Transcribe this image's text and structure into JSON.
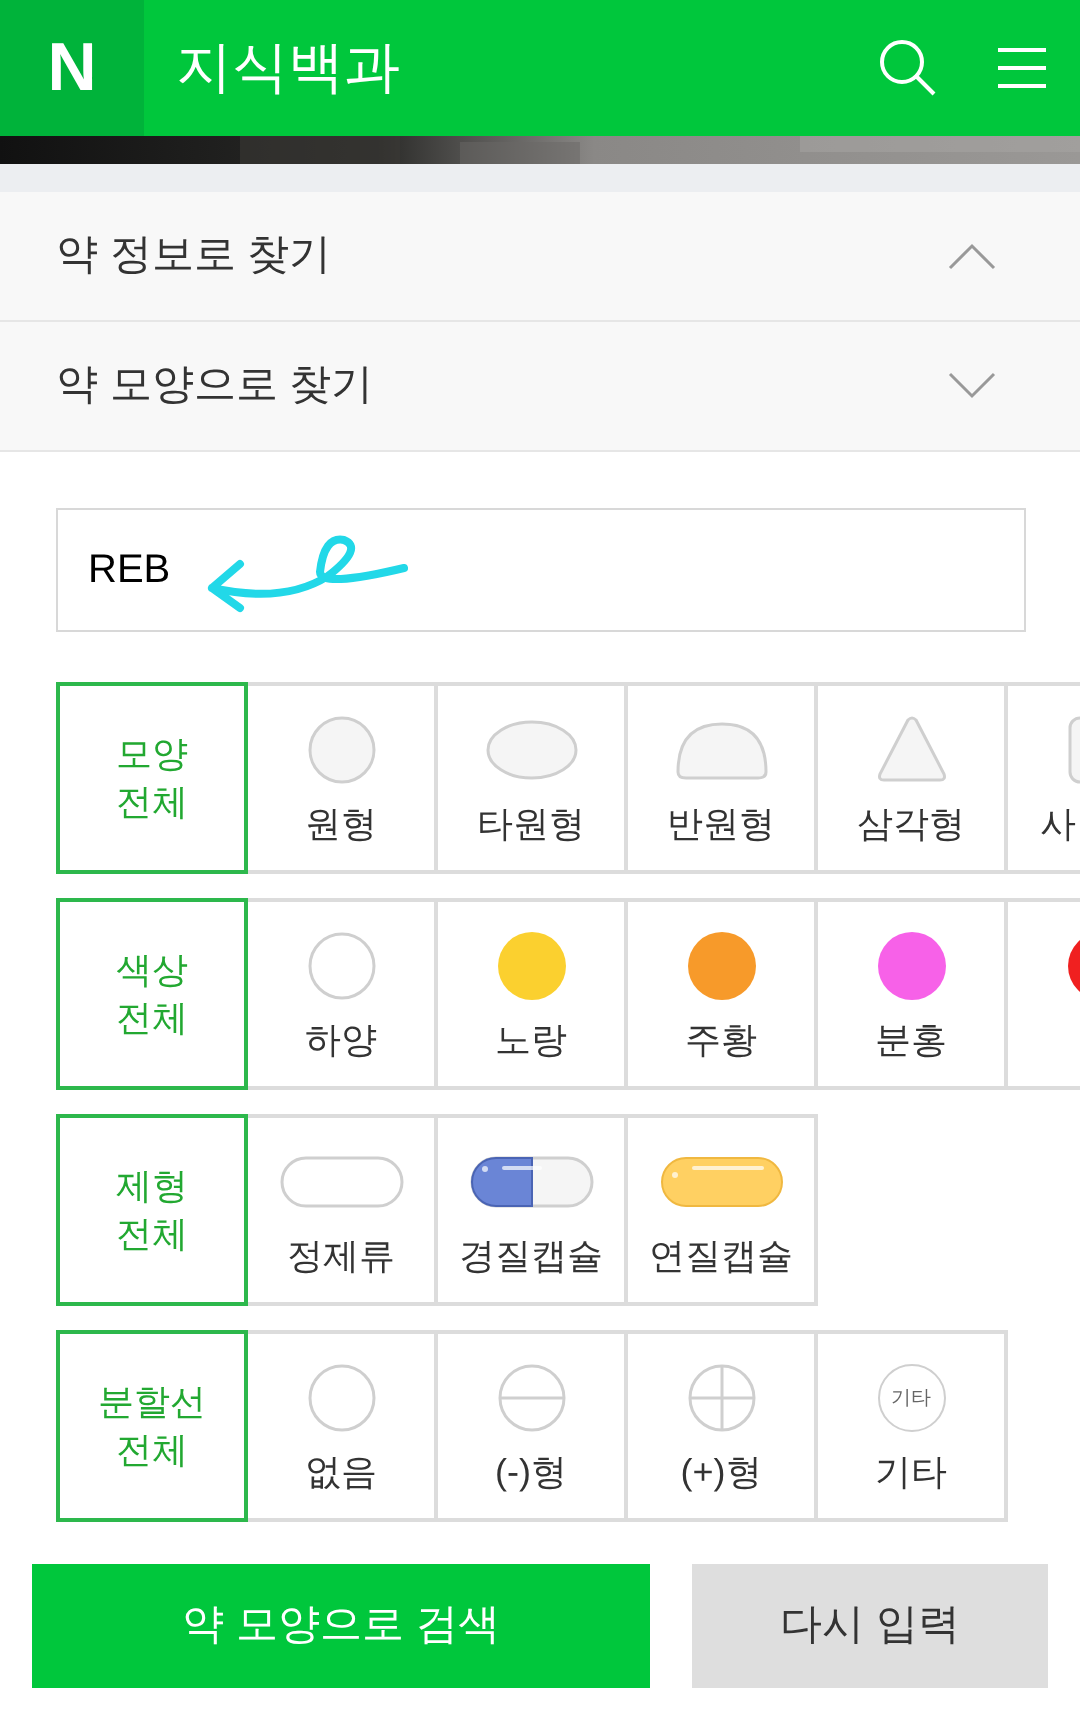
{
  "header": {
    "logo": "N",
    "title": "지식백과"
  },
  "accordion": [
    {
      "label": "약 정보로 찾기",
      "expanded": true
    },
    {
      "label": "약 모양으로 찾기",
      "expanded": false
    }
  ],
  "search": {
    "value": "REB"
  },
  "filters": [
    {
      "label": "모양 전체",
      "selected": true,
      "items": [
        {
          "kind": "circle",
          "label": "원형",
          "selected": false
        },
        {
          "kind": "oval",
          "label": "타원형",
          "selected": false
        },
        {
          "kind": "semicircle",
          "label": "반원형",
          "selected": false
        },
        {
          "kind": "triangle",
          "label": "삼각형",
          "selected": false
        },
        {
          "kind": "square",
          "label": "사",
          "selected": false
        }
      ]
    },
    {
      "label": "색상 전체",
      "selected": true,
      "items": [
        {
          "kind": "color",
          "color": "#ffffff",
          "label": "하양",
          "selected": false
        },
        {
          "kind": "color",
          "color": "#fbd02f",
          "label": "노랑",
          "selected": false
        },
        {
          "kind": "color",
          "color": "#f79a2a",
          "label": "주황",
          "selected": false
        },
        {
          "kind": "color",
          "color": "#f761e8",
          "label": "분홍",
          "selected": false
        },
        {
          "kind": "color",
          "color": "#f02020",
          "selected": false
        }
      ]
    },
    {
      "label": "제형 전체",
      "selected": true,
      "items": [
        {
          "kind": "tablet",
          "label": "정제류",
          "selected": false
        },
        {
          "kind": "hard_capsule",
          "label": "경질캡슐",
          "selected": false
        },
        {
          "kind": "soft_capsule",
          "label": "연질캡슐",
          "selected": false
        }
      ]
    },
    {
      "label": "분할선 전체",
      "selected": true,
      "items": [
        {
          "kind": "none",
          "label": "없음",
          "selected": false
        },
        {
          "kind": "minus",
          "label": "(-)형",
          "selected": false
        },
        {
          "kind": "plus",
          "label": "(+)형",
          "selected": false
        },
        {
          "kind": "other",
          "icon_text": "기타",
          "label": "기타",
          "selected": false
        }
      ]
    }
  ],
  "buttons": [
    {
      "kind": "primary",
      "label": "약 모양으로 검색"
    },
    {
      "kind": "secondary",
      "label": "다시 입력"
    }
  ]
}
